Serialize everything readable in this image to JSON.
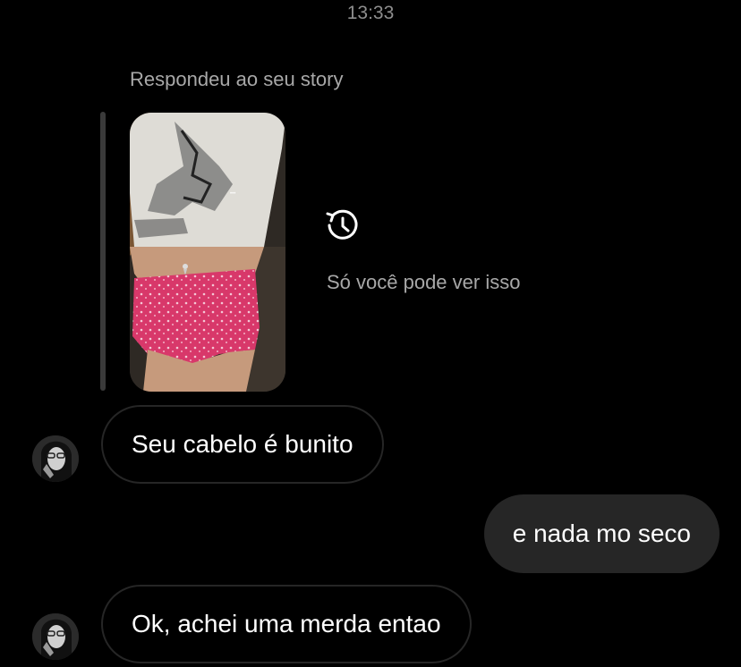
{
  "timestamp": "13:33",
  "story_reply": {
    "context_label": "Respondeu ao seu story",
    "expired_icon": "history-icon",
    "expired_text": "Só você pode ver isso"
  },
  "messages": [
    {
      "direction": "incoming",
      "text": "Seu cabelo é bunito",
      "avatar": "avatar-photo"
    },
    {
      "direction": "outgoing",
      "text": "e nada mo seco"
    },
    {
      "direction": "incoming",
      "text": "Ok, achei uma merda entao",
      "avatar": "avatar-photo"
    }
  ],
  "colors": {
    "background": "#000000",
    "incoming_bubble_border": "#262626",
    "outgoing_bubble": "#262626",
    "secondary_text": "#a8a8a8"
  }
}
